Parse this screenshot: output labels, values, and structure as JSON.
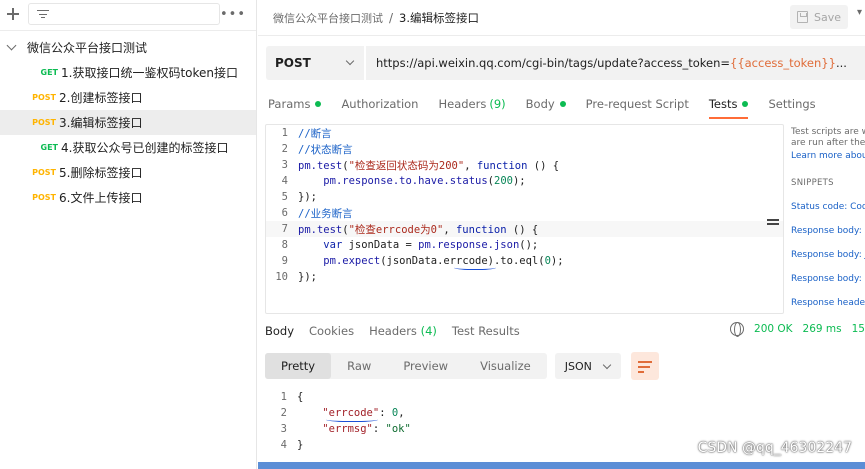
{
  "sidebar": {
    "collection": "微信公众平台接口测试",
    "requests": [
      {
        "method": "GET",
        "name": "1.获取接口统一鉴权码token接口"
      },
      {
        "method": "POST",
        "name": "2.创建标签接口"
      },
      {
        "method": "POST",
        "name": "3.编辑标签接口"
      },
      {
        "method": "GET",
        "name": "4.获取公众号已创建的标签接口"
      },
      {
        "method": "POST",
        "name": "5.删除标签接口"
      },
      {
        "method": "POST",
        "name": "6.文件上传接口"
      }
    ],
    "more_label": "•••"
  },
  "header": {
    "breadcrumb_parent": "微信公众平台接口测试",
    "breadcrumb_sep": "/",
    "breadcrumb_current": "3.编辑标签接口",
    "save_label": "Save"
  },
  "request": {
    "method": "POST",
    "url_prefix": "https://api.weixin.qq.com/cgi-bin/tags/update?access_token=",
    "url_variable": "{{access_token}}",
    "url_suffix": " ..."
  },
  "tabs": [
    {
      "label": "Params",
      "dot": true
    },
    {
      "label": "Authorization"
    },
    {
      "label": "Headers",
      "count": "(9)"
    },
    {
      "label": "Body",
      "dot": true
    },
    {
      "label": "Pre-request Script"
    },
    {
      "label": "Tests",
      "dot": true,
      "active": true
    },
    {
      "label": "Settings"
    }
  ],
  "editor": {
    "lines": [
      "//断言",
      "//状态断言",
      "pm.test(\"检查返回状态码为200\", function () {",
      "    pm.response.to.have.status(200);",
      "});",
      "//业务断言",
      "pm.test(\"检查errcode为0\", function () {",
      "    var jsonData = pm.response.json();",
      "    pm.expect(jsonData.errcode).to.eql(0);",
      "});"
    ]
  },
  "snippets": {
    "desc_1": "Test scripts are w",
    "desc_2": "are run after the r",
    "learn_more": "Learn more about",
    "title": "SNIPPETS",
    "items": [
      "Status code: Code",
      "Response body: C",
      "Response body: J",
      "Response body: Is",
      "Response headers"
    ]
  },
  "response": {
    "tabs": [
      {
        "label": "Body",
        "active": true
      },
      {
        "label": "Cookies"
      },
      {
        "label": "Headers",
        "count": "(4)"
      },
      {
        "label": "Test Results"
      }
    ],
    "status": "200 OK",
    "time": "269 ms",
    "size": "15",
    "views": [
      "Pretty",
      "Raw",
      "Preview",
      "Visualize"
    ],
    "active_view": "Pretty",
    "format": "JSON",
    "body_lines": [
      "{",
      "\"errcode\": 0,",
      "\"errmsg\": \"ok\"",
      "}"
    ]
  },
  "watermark": "CSDN @qq_46302247",
  "colors": {
    "accent": "#ff6c37",
    "get": "#0cbb52",
    "post": "#ffb400",
    "ok": "#0cbb52"
  }
}
